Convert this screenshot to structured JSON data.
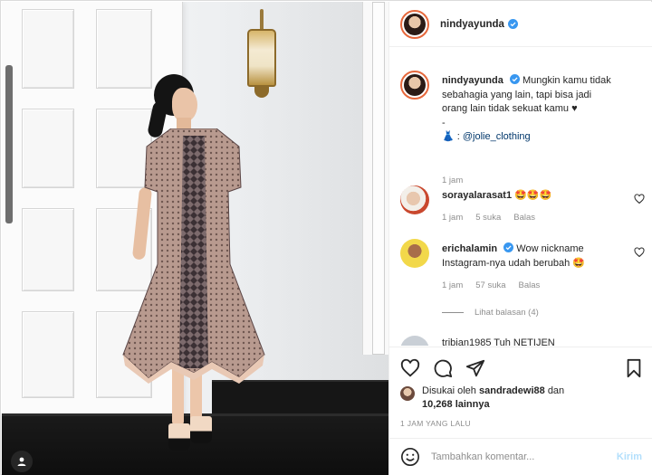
{
  "post": {
    "username": "nindyayunda",
    "verified": true,
    "caption_line1": "Mungkin kamu tidak",
    "caption_line2": "sebahagia yang lain, tapi bisa jadi",
    "caption_line3": "orang lain tidak sekuat kamu ♥",
    "caption_dash": "-",
    "credit_prefix": "👗 : ",
    "credit_handle": "@jolie_clothing",
    "caption_time": "1 jam"
  },
  "comments": [
    {
      "username": "sorayalarasat1",
      "text": "🤩🤩🤩",
      "time": "1 jam",
      "likes": "5 suka",
      "reply_label": "Balas"
    },
    {
      "username": "erichalamin",
      "verified": true,
      "text_line1": "Wow nickname",
      "text_line2": "Instagram-nya udah berubah 🤩",
      "time": "1 jam",
      "likes": "57 suka",
      "reply_label": "Balas",
      "view_replies": "Lihat balasan (4)"
    }
  ],
  "cutoff_comment": "tribian1985  Tuh NETIJEN",
  "liked_by": {
    "prefix": "Disukai oleh",
    "user": "sandradewi88",
    "joiner": "dan",
    "others": "10,268 lainnya"
  },
  "timestamp": "1 JAM YANG LALU",
  "comment_box": {
    "placeholder": "Tambahkan komentar...",
    "post_label": "Kirim"
  },
  "icons": {
    "like": "heart-icon",
    "comment": "comment-icon",
    "share": "share-icon",
    "save": "bookmark-icon",
    "emoji": "smiley-icon",
    "verified": "verified-badge-icon",
    "tagged_user": "user-tag-icon"
  },
  "colors": {
    "verified_blue": "#3897f0",
    "link": "#00376b",
    "meta_gray": "#8e8e8e",
    "post_disabled": "#b2dffc"
  }
}
